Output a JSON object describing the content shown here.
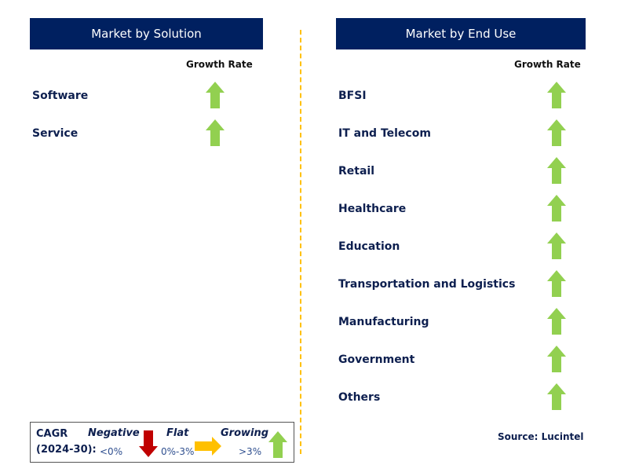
{
  "left": {
    "title": "Market by Solution",
    "growth_header": "Growth Rate",
    "items": [
      {
        "label": "Software",
        "trend": "growing"
      },
      {
        "label": "Service",
        "trend": "growing"
      }
    ]
  },
  "right": {
    "title": "Market by End Use",
    "growth_header": "Growth Rate",
    "items": [
      {
        "label": "BFSI",
        "trend": "growing"
      },
      {
        "label": "IT and Telecom",
        "trend": "growing"
      },
      {
        "label": "Retail",
        "trend": "growing"
      },
      {
        "label": "Healthcare",
        "trend": "growing"
      },
      {
        "label": "Education",
        "trend": "growing"
      },
      {
        "label": "Transportation and Logistics",
        "trend": "growing"
      },
      {
        "label": "Manufacturing",
        "trend": "growing"
      },
      {
        "label": "Government",
        "trend": "growing"
      },
      {
        "label": "Others",
        "trend": "growing"
      }
    ]
  },
  "legend": {
    "cagr": "CAGR",
    "period": "(2024-30):",
    "negative": "Negative",
    "negative_range": "<0%",
    "flat": "Flat",
    "flat_range": "0%-3%",
    "growing": "Growing",
    "growing_range": ">3%"
  },
  "source": "Source: Lucintel",
  "colors": {
    "header": "#002060",
    "growing": "#92d050",
    "negative": "#c00000",
    "flat": "#ffc000",
    "divider": "#ffc000"
  }
}
